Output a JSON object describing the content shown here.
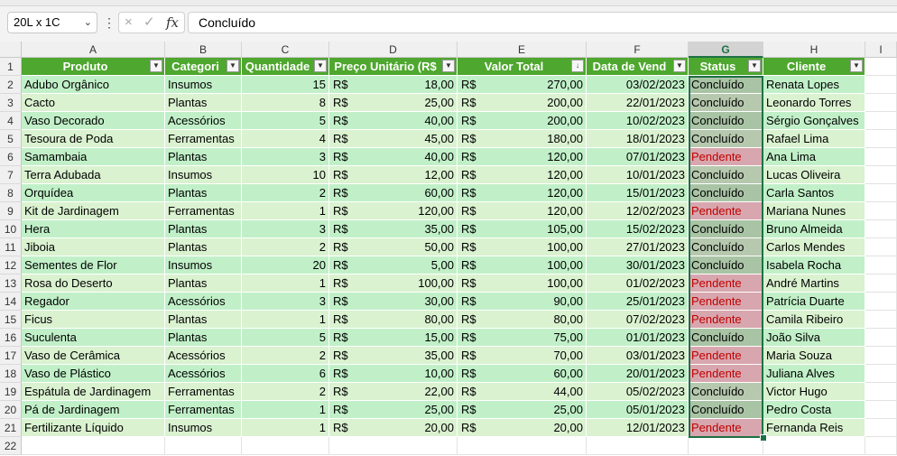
{
  "formula_bar": {
    "name_box": "20L x 1C",
    "chevron_icon": "chevron-down-icon",
    "more_icon": "⋮",
    "cancel_icon": "×",
    "confirm_icon": "✓",
    "function_icon": "fx",
    "value": "Concluído"
  },
  "columns": [
    "A",
    "B",
    "C",
    "D",
    "E",
    "F",
    "G",
    "H",
    "I"
  ],
  "selected_column": "G",
  "row_numbers": [
    "1",
    "2",
    "3",
    "4",
    "5",
    "6",
    "7",
    "8",
    "9",
    "10",
    "11",
    "12",
    "13",
    "14",
    "15",
    "16",
    "17",
    "18",
    "19",
    "20",
    "21",
    "22"
  ],
  "table": {
    "headers": [
      "Produto",
      "Categori",
      "Quantidade",
      "Preço Unitário (R$",
      "Valor Total",
      "Data de Vend",
      "Status",
      "Cliente"
    ],
    "currency": "R$",
    "rows": [
      [
        "Adubo Orgânico",
        "Insumos",
        "15",
        "18,00",
        "270,00",
        "03/02/2023",
        "Concluído",
        "Renata Lopes"
      ],
      [
        "Cacto",
        "Plantas",
        "8",
        "25,00",
        "200,00",
        "22/01/2023",
        "Concluído",
        "Leonardo Torres"
      ],
      [
        "Vaso Decorado",
        "Acessórios",
        "5",
        "40,00",
        "200,00",
        "10/02/2023",
        "Concluído",
        "Sérgio Gonçalves"
      ],
      [
        "Tesoura de Poda",
        "Ferramentas",
        "4",
        "45,00",
        "180,00",
        "18/01/2023",
        "Concluído",
        "Rafael Lima"
      ],
      [
        "Samambaia",
        "Plantas",
        "3",
        "40,00",
        "120,00",
        "07/01/2023",
        "Pendente",
        "Ana Lima"
      ],
      [
        "Terra Adubada",
        "Insumos",
        "10",
        "12,00",
        "120,00",
        "10/01/2023",
        "Concluído",
        "Lucas Oliveira"
      ],
      [
        "Orquídea",
        "Plantas",
        "2",
        "60,00",
        "120,00",
        "15/01/2023",
        "Concluído",
        "Carla Santos"
      ],
      [
        "Kit de Jardinagem",
        "Ferramentas",
        "1",
        "120,00",
        "120,00",
        "12/02/2023",
        "Pendente",
        "Mariana Nunes"
      ],
      [
        "Hera",
        "Plantas",
        "3",
        "35,00",
        "105,00",
        "15/02/2023",
        "Concluído",
        "Bruno Almeida"
      ],
      [
        "Jiboia",
        "Plantas",
        "2",
        "50,00",
        "100,00",
        "27/01/2023",
        "Concluído",
        "Carlos Mendes"
      ],
      [
        "Sementes de Flor",
        "Insumos",
        "20",
        "5,00",
        "100,00",
        "30/01/2023",
        "Concluído",
        "Isabela Rocha"
      ],
      [
        "Rosa do Deserto",
        "Plantas",
        "1",
        "100,00",
        "100,00",
        "01/02/2023",
        "Pendente",
        "André Martins"
      ],
      [
        "Regador",
        "Acessórios",
        "3",
        "30,00",
        "90,00",
        "25/01/2023",
        "Pendente",
        "Patrícia Duarte"
      ],
      [
        "Ficus",
        "Plantas",
        "1",
        "80,00",
        "80,00",
        "07/02/2023",
        "Pendente",
        "Camila Ribeiro"
      ],
      [
        "Suculenta",
        "Plantas",
        "5",
        "15,00",
        "75,00",
        "01/01/2023",
        "Concluído",
        "João Silva"
      ],
      [
        "Vaso de Cerâmica",
        "Acessórios",
        "2",
        "35,00",
        "70,00",
        "03/01/2023",
        "Pendente",
        "Maria Souza"
      ],
      [
        "Vaso de Plástico",
        "Acessórios",
        "6",
        "10,00",
        "60,00",
        "20/01/2023",
        "Pendente",
        "Juliana Alves"
      ],
      [
        "Espátula de Jardinagem",
        "Ferramentas",
        "2",
        "22,00",
        "44,00",
        "05/02/2023",
        "Concluído",
        "Victor Hugo"
      ],
      [
        "Pá de Jardinagem",
        "Ferramentas",
        "1",
        "25,00",
        "25,00",
        "05/01/2023",
        "Concluído",
        "Pedro Costa"
      ],
      [
        "Fertilizante Líquido",
        "Insumos",
        "1",
        "20,00",
        "20,00",
        "12/01/2023",
        "Pendente",
        "Fernanda Reis"
      ]
    ]
  },
  "filter_icon": "▼",
  "sort_desc_icon": "↓",
  "colors": {
    "header_green": "#4ea72e",
    "band_light": "#daf2d0",
    "band_dark": "#c1f0c8",
    "status_done": "#a9c4a5",
    "status_pending": "#d8a6ae",
    "pending_text": "#c00000",
    "selection": "#1e7145"
  }
}
